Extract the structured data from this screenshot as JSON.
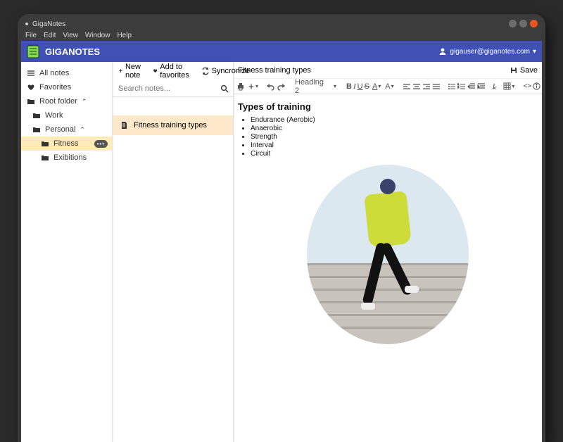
{
  "window": {
    "title": "GigaNotes"
  },
  "menubar": {
    "items": [
      "File",
      "Edit",
      "View",
      "Window",
      "Help"
    ]
  },
  "brand": {
    "name": "GIGANOTES"
  },
  "user": {
    "email": "gigauser@giganotes.com"
  },
  "sidebar": {
    "all_notes": "All notes",
    "favorites": "Favorites",
    "root": "Root folder",
    "work": "Work",
    "personal": "Personal",
    "fitness": "Fitness",
    "exibitions": "Exibitions"
  },
  "toolbar": {
    "new_note": "New note",
    "add_fav": "Add to favorites",
    "sync": "Syncronize"
  },
  "search": {
    "placeholder": "Search notes..."
  },
  "notes": {
    "items": [
      "Fitness training types"
    ]
  },
  "editor": {
    "title": "Fitness training types",
    "save": "Save",
    "heading_selector": "Heading 2",
    "content_heading": "Types of training",
    "bullets": [
      "Endurance (Aerobic)",
      "Anaerobic",
      "Strength",
      "Interval",
      "Circuit"
    ]
  }
}
